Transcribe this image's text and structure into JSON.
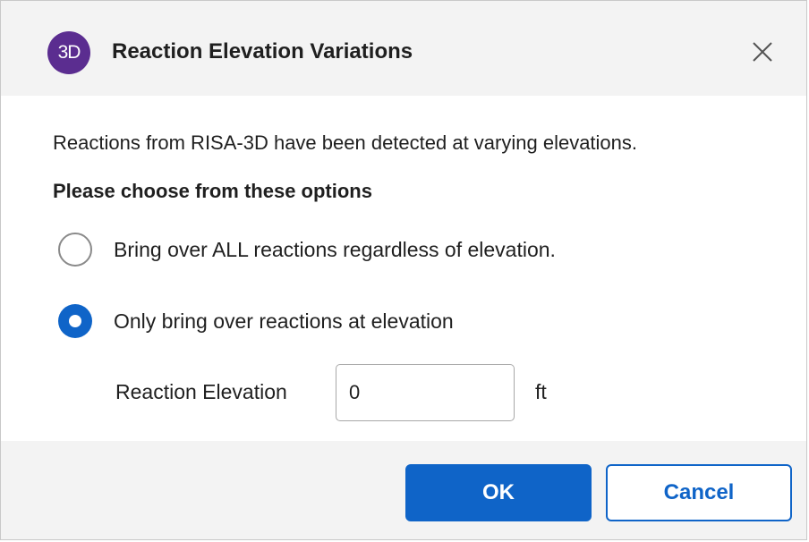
{
  "window": {
    "title": "Reaction Elevation Variations",
    "app_icon_text": "3D",
    "app_icon_color": "#5b2d90",
    "close_icon": "close-icon"
  },
  "content": {
    "message": "Reactions from RISA-3D have been detected at varying elevations.",
    "prompt": "Please choose from these options",
    "options": [
      {
        "label": "Bring over ALL reactions regardless of elevation.",
        "selected": false
      },
      {
        "label": "Only bring over reactions at elevation",
        "selected": true
      }
    ],
    "elevation": {
      "label": "Reaction Elevation",
      "value": "0",
      "unit": "ft"
    }
  },
  "footer": {
    "ok_label": "OK",
    "cancel_label": "Cancel",
    "accent_color": "#0f64c8"
  }
}
